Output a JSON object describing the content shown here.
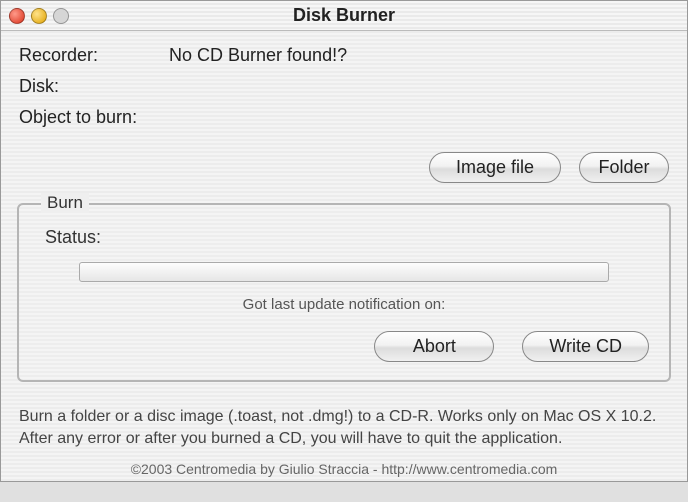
{
  "window": {
    "title": "Disk Burner"
  },
  "fields": {
    "recorder_label": "Recorder:",
    "recorder_value": "No CD Burner found!?",
    "disk_label": "Disk:",
    "disk_value": "",
    "object_label": "Object to burn:",
    "object_value": ""
  },
  "buttons": {
    "image_file": "Image file",
    "folder": "Folder",
    "abort": "Abort",
    "write_cd": "Write CD"
  },
  "burn_group": {
    "legend": "Burn",
    "status_label": "Status:",
    "status_value": "",
    "update_note": "Got last update notification on:"
  },
  "footer": {
    "help": "Burn a folder or a disc image (.toast, not .dmg!) to a CD-R. Works only on Mac OS X 10.2. After any error or after you burned a CD, you will have to quit the application.",
    "copyright": "©2003 Centromedia by Giulio Straccia - http://www.centromedia.com"
  }
}
